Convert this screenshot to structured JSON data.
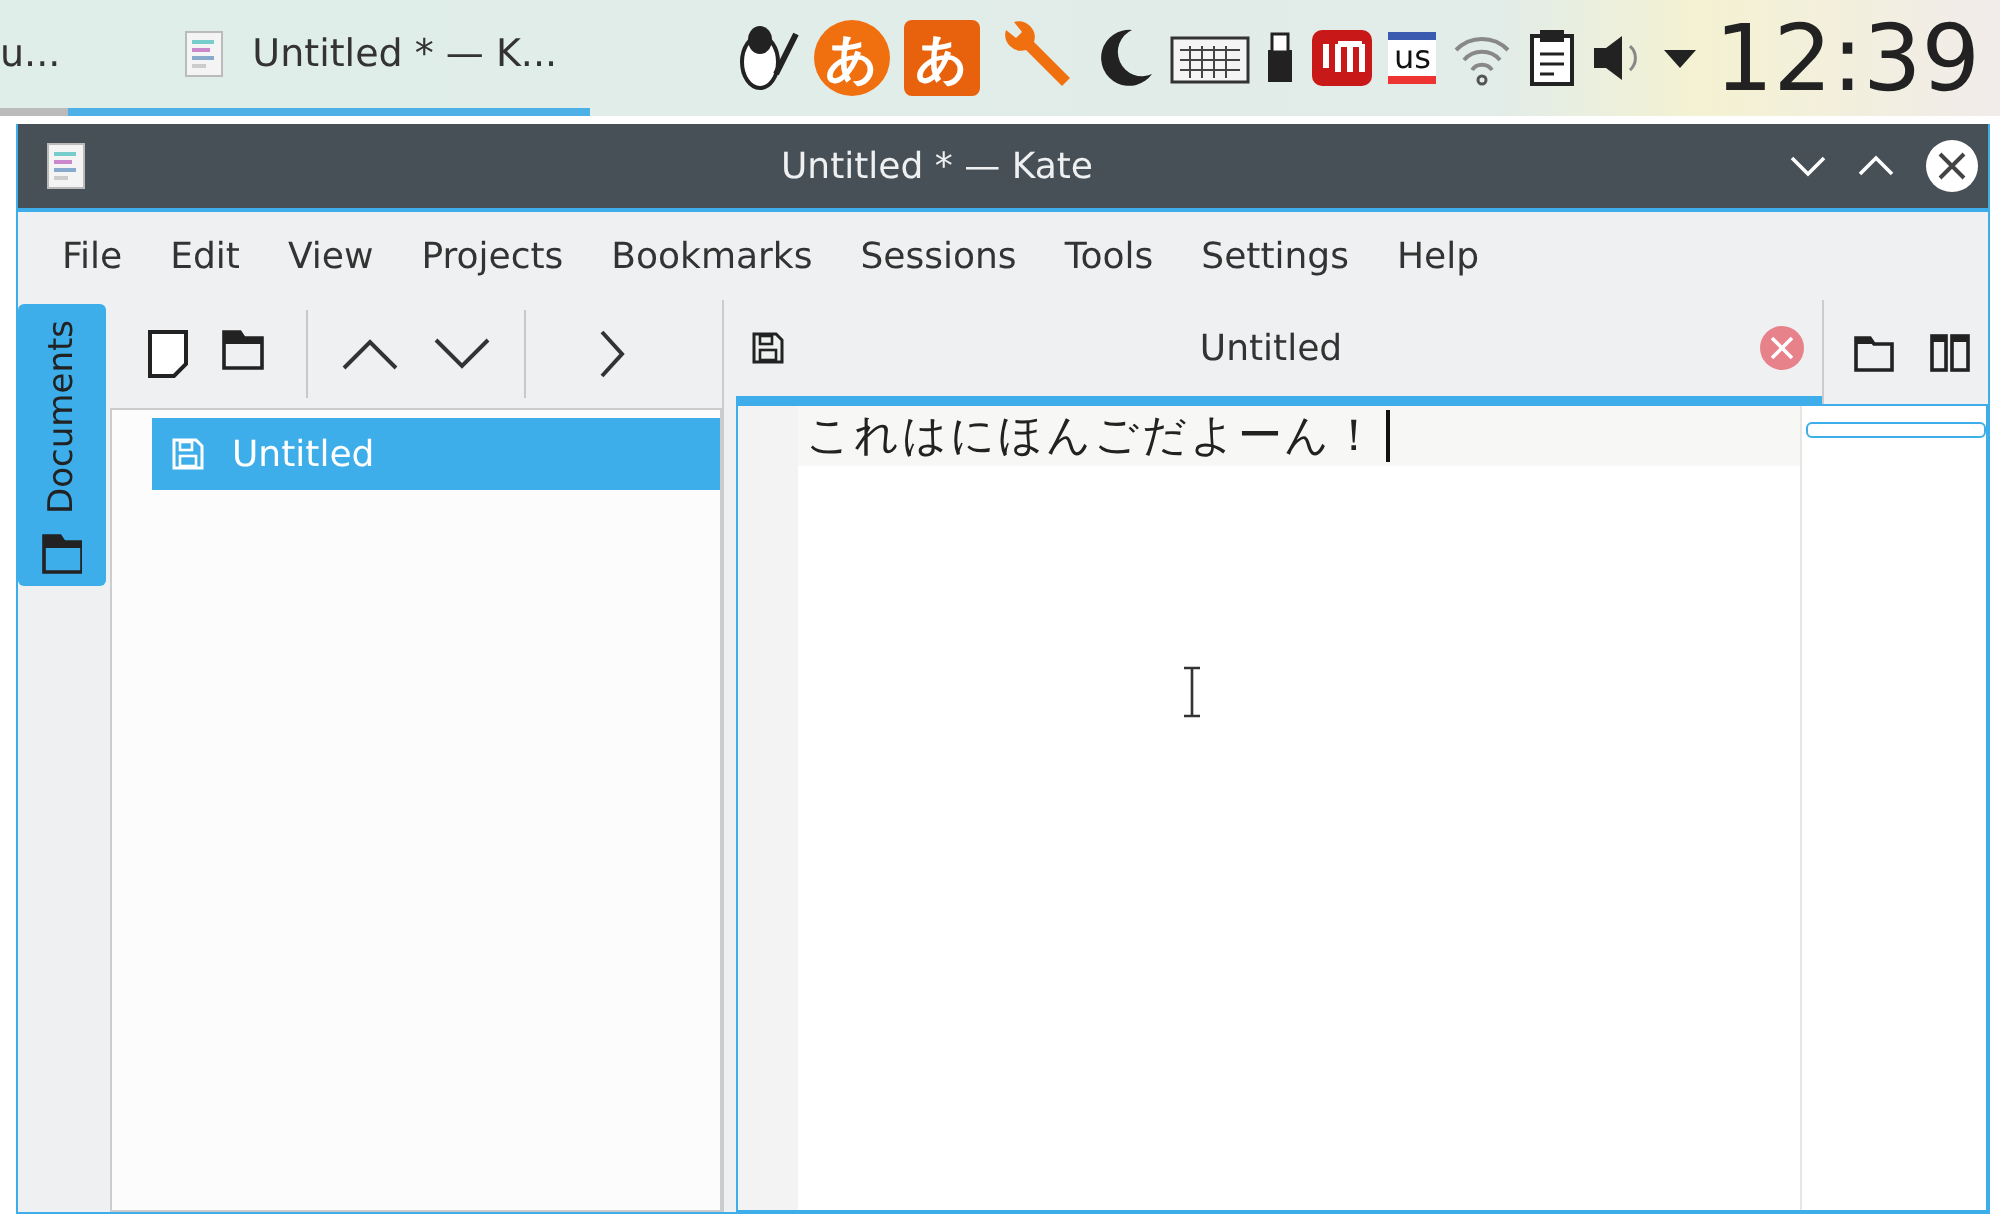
{
  "taskbar": {
    "tasks": [
      {
        "label": "u...",
        "selected": false
      },
      {
        "label": "Untitled * — K...",
        "selected": true
      }
    ],
    "ime_indicators": [
      "あ",
      "あ"
    ],
    "keyboard_layout": "us",
    "clock": "12:39"
  },
  "window": {
    "title": "Untitled * — Kate"
  },
  "menu": [
    "File",
    "Edit",
    "View",
    "Projects",
    "Bookmarks",
    "Sessions",
    "Tools",
    "Settings",
    "Help"
  ],
  "side_tabs": [
    {
      "label": "Documents",
      "selected": true
    }
  ],
  "documents": [
    {
      "name": "Untitled",
      "selected": true
    }
  ],
  "editor": {
    "tabs": [
      {
        "label": "Untitled",
        "selected": true,
        "modified": true
      }
    ],
    "lines": [
      "これはにほんごだよーん！"
    ]
  }
}
